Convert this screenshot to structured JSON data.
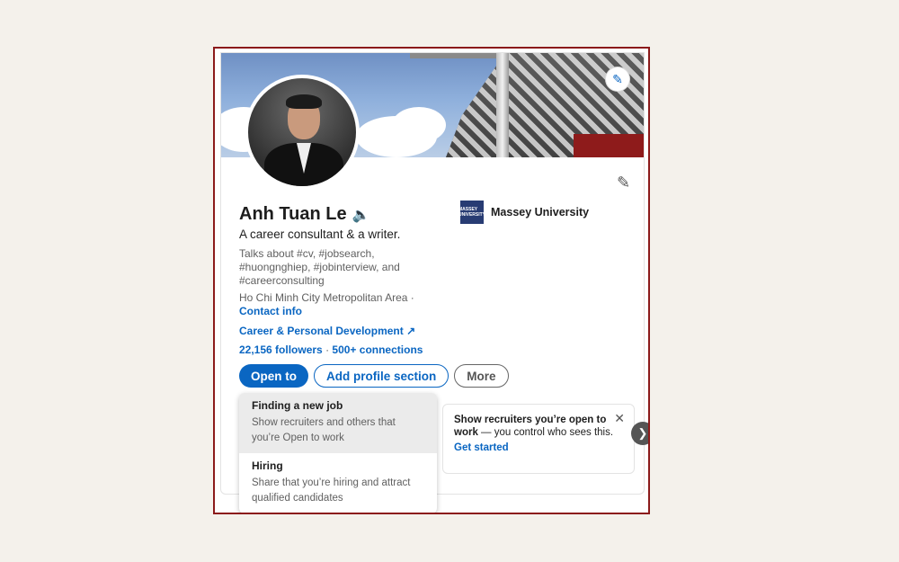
{
  "profile": {
    "name": "Anh Tuan Le",
    "headline": "A career consultant & a writer.",
    "talks_about": "Talks about #cv, #jobsearch, #huongnghiep, #jobinterview, and #careerconsulting",
    "location": "Ho Chi Minh City Metropolitan Area ·",
    "contact_info": "Contact info",
    "website": "Career & Personal Development",
    "followers": "22,156 followers",
    "separator": "·",
    "connections": "500+ connections"
  },
  "education": {
    "name": "Massey University",
    "logo_text": "MASSEY UNIVERSITY"
  },
  "buttons": {
    "open_to": "Open to",
    "add_section": "Add profile section",
    "more": "More"
  },
  "open_to_menu": [
    {
      "title": "Finding a new job",
      "description": "Show recruiters and others that you’re Open to work"
    },
    {
      "title": "Hiring",
      "description": "Share that you’re hiring and attract qualified candidates"
    }
  ],
  "promo": {
    "bold_text": "Show recruiters you’re open to work",
    "text": " — you control who sees this.",
    "link": "Get started"
  },
  "icons": {
    "banner_edit": "pencil-icon",
    "profile_edit": "pencil-icon",
    "speaker": "speaker-icon",
    "external_link": "external-link-icon",
    "close": "close-icon",
    "carousel_next": "chevron-right-icon"
  },
  "colors": {
    "accent": "#0a66c2",
    "frame": "#8b1a1a"
  }
}
